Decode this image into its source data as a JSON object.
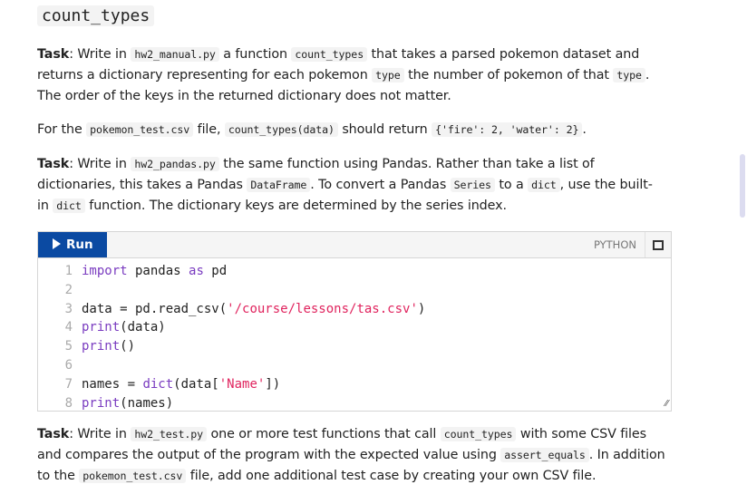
{
  "title": "count_types",
  "p1": {
    "task": "Task",
    "a": ": Write in ",
    "f1": "hw2_manual.py",
    "b": " a function ",
    "f2": "count_types",
    "c": " that takes a parsed pokemon dataset and",
    "d": "returns a dictionary representing for each pokemon ",
    "f3": "type",
    "e": " the number of pokemon of that ",
    "f4": "type",
    "g": ".",
    "h": "The order of the keys in the returned dictionary does not matter."
  },
  "p2": {
    "a": "For the ",
    "f1": "pokemon_test.csv",
    "b": " file, ",
    "f2": "count_types(data)",
    "c": " should return ",
    "f3": "{'fire': 2, 'water': 2}",
    "d": "."
  },
  "p3": {
    "task": "Task",
    "a": ": Write in ",
    "f1": "hw2_pandas.py",
    "b": " the same function using Pandas. Rather than take a list of",
    "c": "dictionaries, this takes a Pandas ",
    "f2": "DataFrame",
    "d": ". To convert a Pandas ",
    "f3": "Series",
    "e": " to a ",
    "f4": "dict",
    "g": ", use the built-",
    "h": "in ",
    "f5": "dict",
    "i": " function. The dictionary keys are determined by the series index."
  },
  "editor": {
    "run_label": "Run",
    "language": "PYTHON",
    "lines": [
      {
        "n": "1",
        "k1": "import",
        "a": " pandas ",
        "k2": "as",
        "b": " pd"
      },
      {
        "n": "2"
      },
      {
        "n": "3",
        "a": "data = pd.read_csv(",
        "s": "'/course/lessons/tas.csv'",
        "b": ")"
      },
      {
        "n": "4",
        "k1": "print",
        "a": "(data)"
      },
      {
        "n": "5",
        "k1": "print",
        "a": "()"
      },
      {
        "n": "6"
      },
      {
        "n": "7",
        "a": "names = ",
        "k1": "dict",
        "b": "(data[",
        "s": "'Name'",
        "c": "])"
      },
      {
        "n": "8",
        "k1": "print",
        "a": "(names)"
      }
    ]
  },
  "p4": {
    "task": "Task",
    "a": ": Write in ",
    "f1": "hw2_test.py",
    "b": " one or more test functions that call ",
    "f2": "count_types",
    "c": " with some CSV files",
    "d": "and compares the output of the program with the expected value using ",
    "f3": "assert_equals",
    "e": ". In addition",
    "g": "to the ",
    "f4": "pokemon_test.csv",
    "h": " file, add one additional test case by creating your own CSV file."
  }
}
